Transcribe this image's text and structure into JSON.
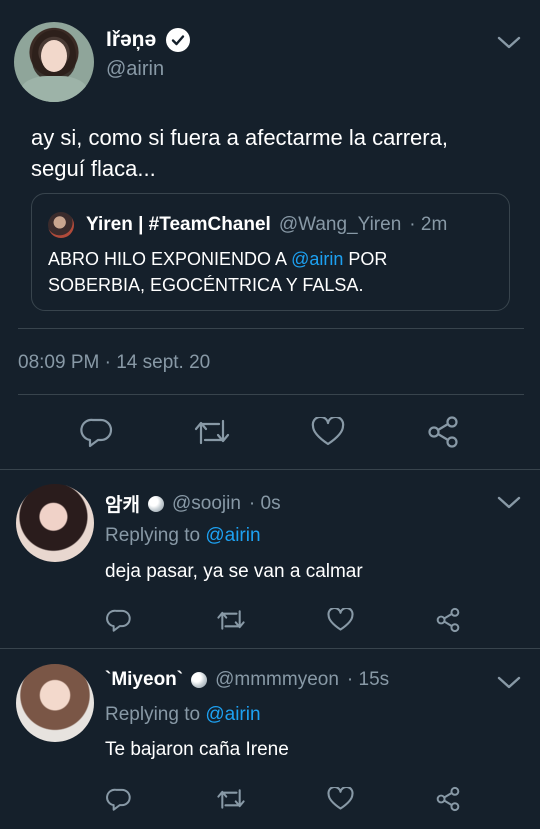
{
  "colors": {
    "background": "#15202b",
    "muted": "#8899a6",
    "link": "#1da1f2",
    "divider": "#38444d"
  },
  "main_tweet": {
    "display_name": "Iřəņə",
    "handle": "@airin",
    "text_line1": "ay si, como si fuera a afectarme la carrera,",
    "text_line2": "seguí flaca...",
    "quote": {
      "display_name": "Yiren | #TeamChanel",
      "handle": "@Wang_Yiren",
      "time": "· 2m",
      "text_line1_prefix": "ABRO HILO EXPONIENDO A ",
      "text_line1_mention": "@airin",
      "text_line1_suffix": " POR",
      "text_line2": "SOBERBIA, EGOCÉNTRICA Y FALSA."
    },
    "timestamp": "08:09 PM · 14 sept. 20",
    "actions": [
      "reply-icon",
      "retweet-icon",
      "like-icon",
      "share-icon"
    ]
  },
  "replies": [
    {
      "display_name": "암캐",
      "handle": "@soojin",
      "time": "· 0s",
      "replying_label": "Replying to",
      "replying_to": "@airin",
      "text": "deja pasar, ya se van a calmar"
    },
    {
      "display_name": "`Miyeon`",
      "handle": "@mmmmyeon",
      "time": "· 15s",
      "replying_label": "Replying to",
      "replying_to": "@airin",
      "text": "Te bajaron caña Irene"
    }
  ]
}
